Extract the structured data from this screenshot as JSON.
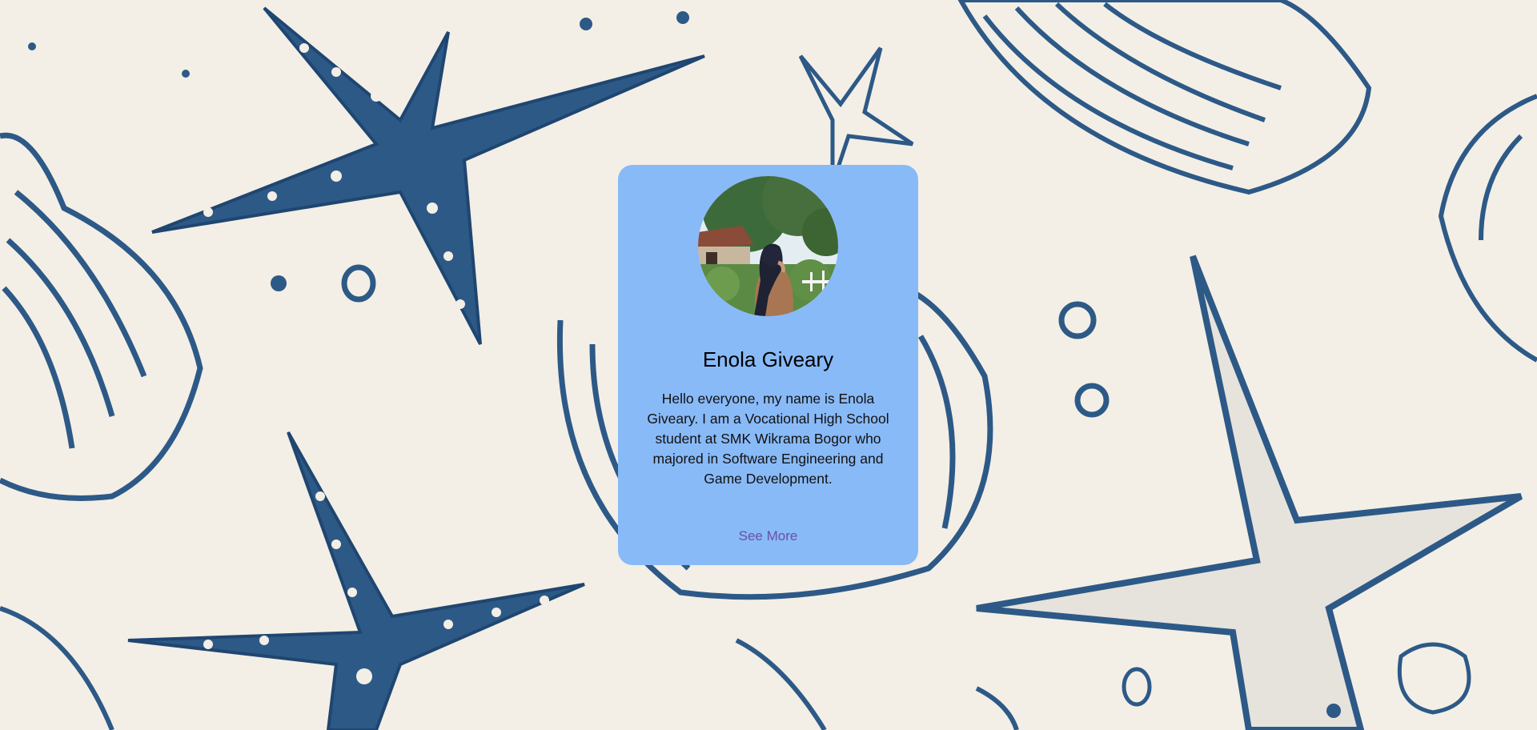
{
  "profile": {
    "name": "Enola Giveary",
    "bio": "Hello everyone, my name is Enola Giveary. I am a Vocational High School student at SMK Wikrama Bogor who majored in Software Engineering and Game Development.",
    "see_more_label": "See More",
    "avatar_icon": "profile-photo"
  },
  "colors": {
    "background": "#f3efe6",
    "pattern": "#2d5987",
    "card": "#89baf8",
    "link": "#6a4fa8"
  }
}
